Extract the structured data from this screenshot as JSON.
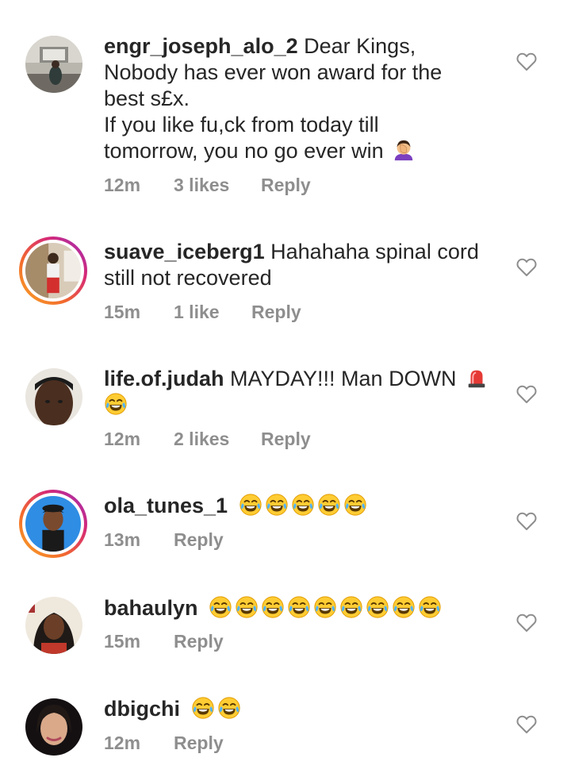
{
  "comments": [
    {
      "username": "engr_joseph_alo_2",
      "text": "Dear Kings,",
      "text_lines": [
        "Nobody has ever won award for the",
        "best s£x.",
        "If you like fu,ck from today till",
        "tomorrow, you no go ever win"
      ],
      "emoji": "woman-facepalming",
      "time": "12m",
      "likes": "3 likes",
      "reply": "Reply",
      "story_ring": false
    },
    {
      "username": "suave_iceberg1",
      "text": "Hahahaha spinal cord",
      "text_lines": [
        "still not recovered"
      ],
      "time": "15m",
      "likes": "1 like",
      "reply": "Reply",
      "story_ring": true
    },
    {
      "username": "life.of.judah",
      "text": "MAYDAY!!! Man DOWN",
      "emoji": "siren-and-laughing-crying",
      "time": "12m",
      "likes": "2 likes",
      "reply": "Reply",
      "story_ring": false
    },
    {
      "username": "ola_tunes_1",
      "emoji_count": 5,
      "emoji": "face-with-tears-of-joy",
      "time": "13m",
      "reply": "Reply",
      "story_ring": true
    },
    {
      "username": "bahaulyn",
      "emoji_count": 9,
      "emoji": "face-with-tears-of-joy",
      "time": "15m",
      "reply": "Reply",
      "story_ring": false
    },
    {
      "username": "dbigchi",
      "emoji_count": 2,
      "emoji": "face-with-tears-of-joy",
      "time": "12m",
      "reply": "Reply",
      "story_ring": false
    }
  ],
  "colors": {
    "text": "#262626",
    "meta": "#8e8e8e",
    "heart_outline": "#8e8e8e",
    "story_ring_start": "#f9a825",
    "story_ring_end": "#962fbf"
  },
  "icons": {
    "like": "heart-outline-icon",
    "laugh": "face-with-tears-of-joy",
    "facepalm": "woman-facepalming",
    "siren": "police-car-light"
  }
}
